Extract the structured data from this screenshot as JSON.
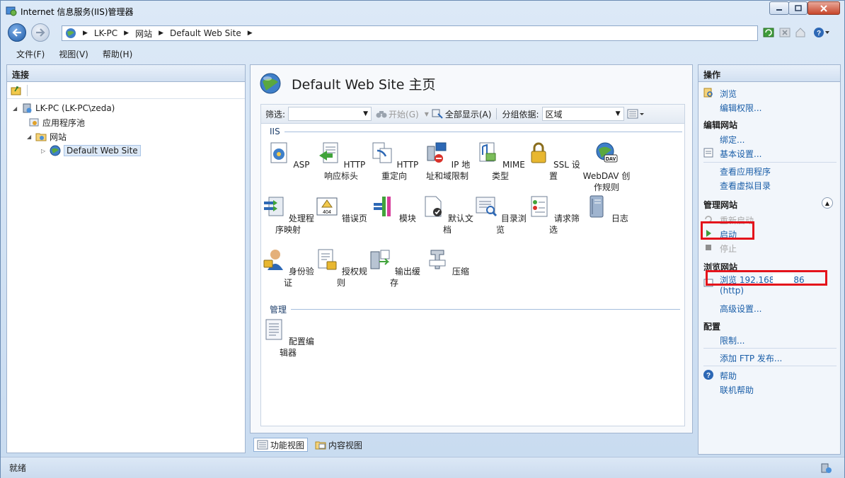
{
  "window": {
    "title": "Internet 信息服务(IIS)管理器"
  },
  "address": {
    "crumbs": [
      "LK-PC",
      "网站",
      "Default Web Site"
    ]
  },
  "menu": [
    "文件(F)",
    "视图(V)",
    "帮助(H)"
  ],
  "connections": {
    "header": "连接",
    "tree": [
      {
        "label": "LK-PC (LK-PC\\zeda)"
      },
      {
        "label": "应用程序池"
      },
      {
        "label": "网站"
      },
      {
        "label": "Default Web Site"
      }
    ]
  },
  "main": {
    "title": "Default Web Site 主页",
    "filter_label": "筛选:",
    "start_label": "开始(G)",
    "show_all_label": "全部显示(A)",
    "group_by_label": "分组依据:",
    "group_by_value": "区域",
    "section_iis": "IIS",
    "section_manage": "管理",
    "features_iis": [
      "ASP",
      "HTTP 响应标头",
      "HTTP 重定向",
      "IP 地址和域限制",
      "MIME 类型",
      "SSL 设置",
      "WebDAV 创作规则",
      "处理程序映射",
      "错误页",
      "模块",
      "默认文档",
      "目录浏览",
      "请求筛选",
      "日志",
      "身份验证",
      "授权规则",
      "输出缓存",
      "压缩"
    ],
    "features_manage": [
      "配置编辑器"
    ],
    "view_tabs": [
      "功能视图",
      "内容视图"
    ]
  },
  "actions": {
    "header": "操作",
    "browse": "浏览",
    "edit_perms": "编辑权限...",
    "edit_site": "编辑网站",
    "bindings": "绑定...",
    "basic_settings": "基本设置...",
    "view_apps": "查看应用程序",
    "view_vdirs": "查看虚拟目录",
    "manage_site": "管理网站",
    "restart": "重新启动",
    "start": "启动",
    "stop": "停止",
    "browse_site": "浏览网站",
    "browse_addr": "浏览 192.168.     :8086",
    "browse_proto": "(http)",
    "advanced": "高级设置...",
    "config": "配置",
    "limits": "限制...",
    "add_ftp": "添加 FTP 发布...",
    "help": "帮助",
    "online_help": "联机帮助"
  },
  "status": {
    "text": "就绪"
  }
}
